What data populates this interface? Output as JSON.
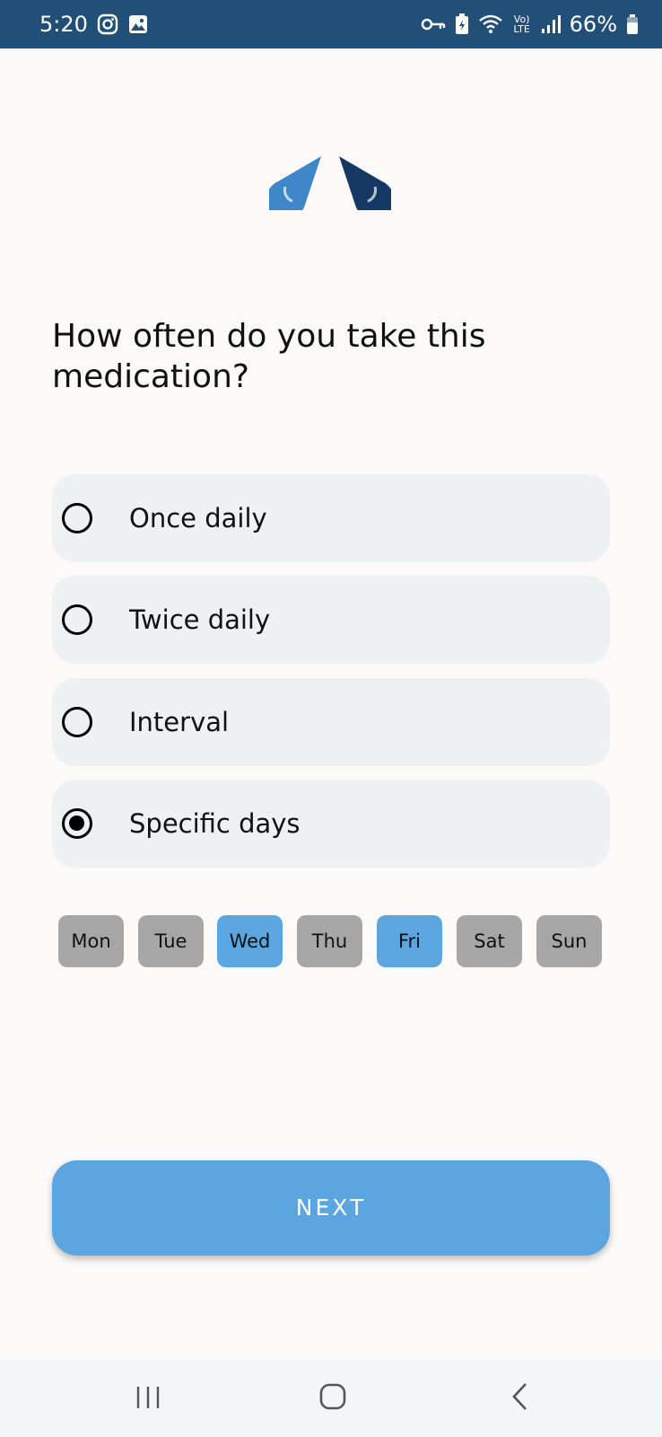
{
  "status_bar": {
    "time": "5:20",
    "battery": "66%",
    "network_label": "Vo) LTE",
    "icons": [
      "instagram-icon",
      "gallery-icon",
      "vpn-key-icon",
      "battery-saver-icon",
      "wifi-icon",
      "signal-icon",
      "battery-icon"
    ]
  },
  "logo": {
    "colors": {
      "left_drop": "#3f87c8",
      "right_drop": "#163964"
    }
  },
  "question": "How often do you take this medication?",
  "options": [
    {
      "label": "Once daily",
      "checked": false
    },
    {
      "label": "Twice daily",
      "checked": false
    },
    {
      "label": "Interval",
      "checked": false
    },
    {
      "label": "Specific days",
      "checked": true
    }
  ],
  "days": [
    {
      "label": "Mon",
      "selected": false
    },
    {
      "label": "Tue",
      "selected": false
    },
    {
      "label": "Wed",
      "selected": true
    },
    {
      "label": "Thu",
      "selected": false
    },
    {
      "label": "Fri",
      "selected": true
    },
    {
      "label": "Sat",
      "selected": false
    },
    {
      "label": "Sun",
      "selected": false
    }
  ],
  "next_button": {
    "label": "NEXT"
  },
  "colors": {
    "status_bar": "#214f78",
    "accent": "#5ba5e0",
    "option_bg": "#edf1f2",
    "day_unselected": "#a6a6a6"
  },
  "nav_bar": {
    "icons": [
      "recent-apps-icon",
      "home-icon",
      "back-icon"
    ]
  }
}
